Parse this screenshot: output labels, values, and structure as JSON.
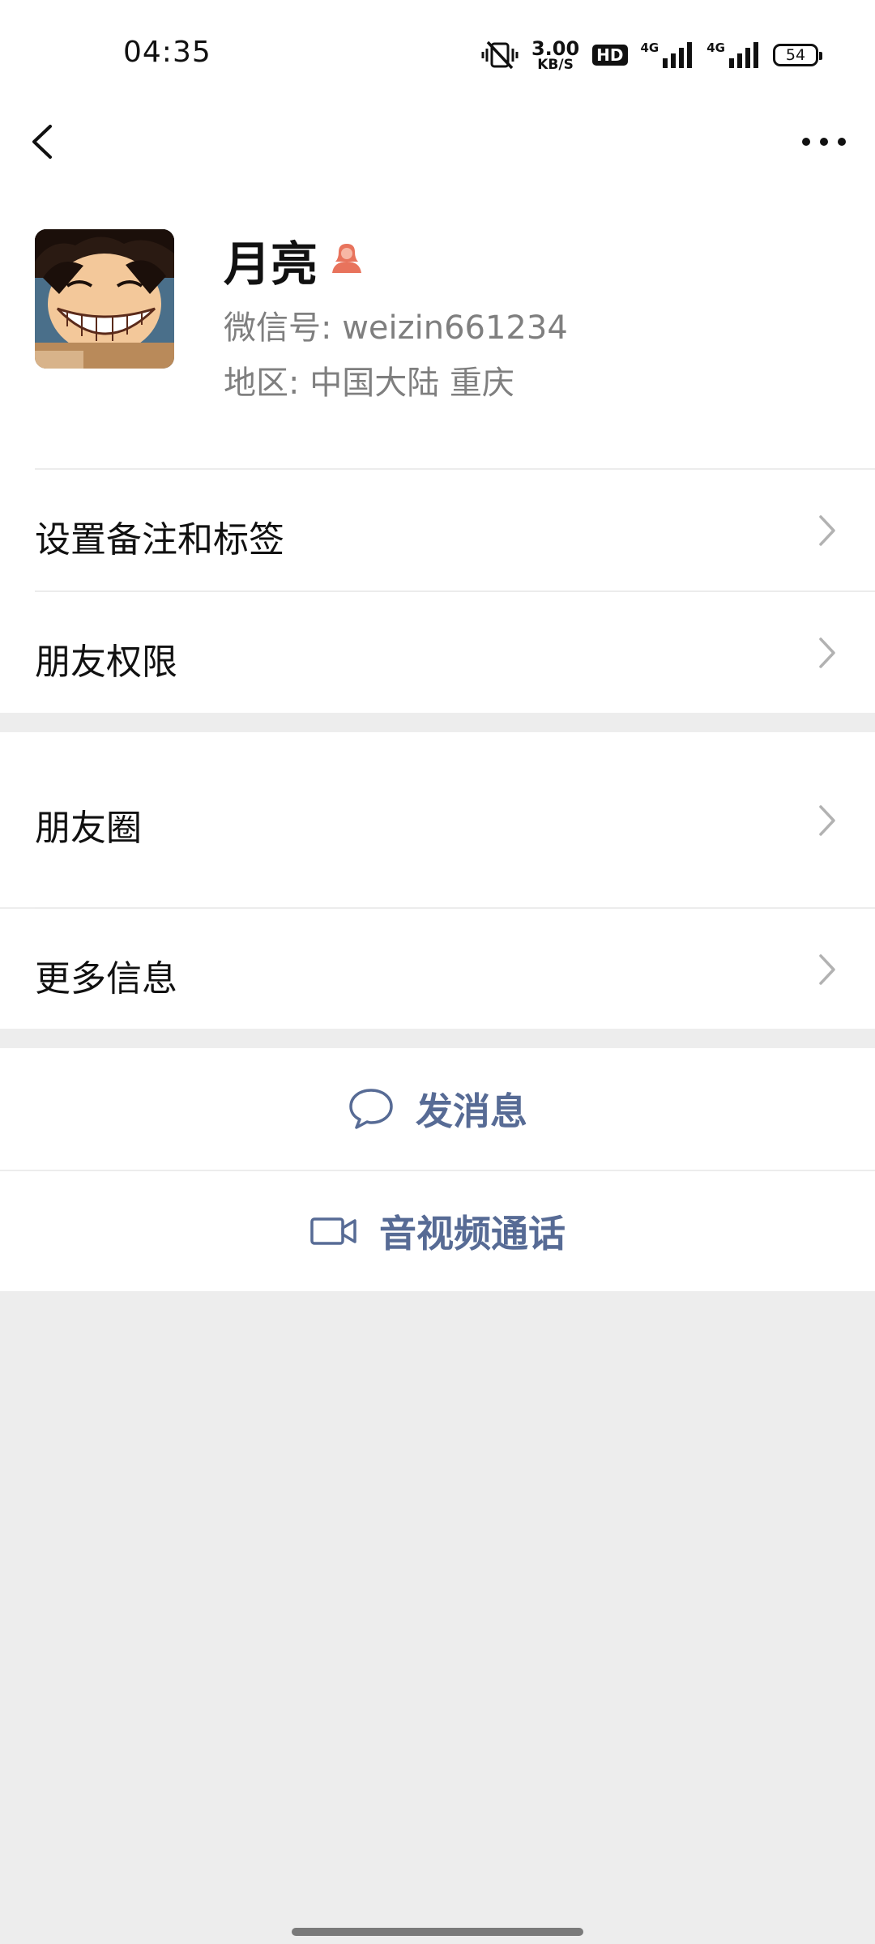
{
  "status_bar": {
    "time": "04:35",
    "net_speed_value": "3.00",
    "net_speed_unit": "KB/S",
    "hd_badge": "HD",
    "network_1": "4G",
    "network_2": "4G",
    "battery": "54"
  },
  "nav": {
    "back_icon": "chevron-left-icon",
    "more_icon": "ellipsis-icon"
  },
  "profile": {
    "nickname": "月亮",
    "gender_icon": "female-person-icon",
    "wechat_id": "微信号:  weizin661234",
    "region": "地区:  中国大陆  重庆"
  },
  "rows": {
    "remark": "设置备注和标签",
    "permissions": "朋友权限",
    "moments": "朋友圈",
    "more_info": "更多信息"
  },
  "actions": {
    "message": "发消息",
    "video_call": "音视频通话"
  },
  "colors": {
    "accent": "#576b95",
    "background": "#ededed",
    "gender_female": "#e8735c",
    "secondary_text": "#7f7f7f"
  }
}
